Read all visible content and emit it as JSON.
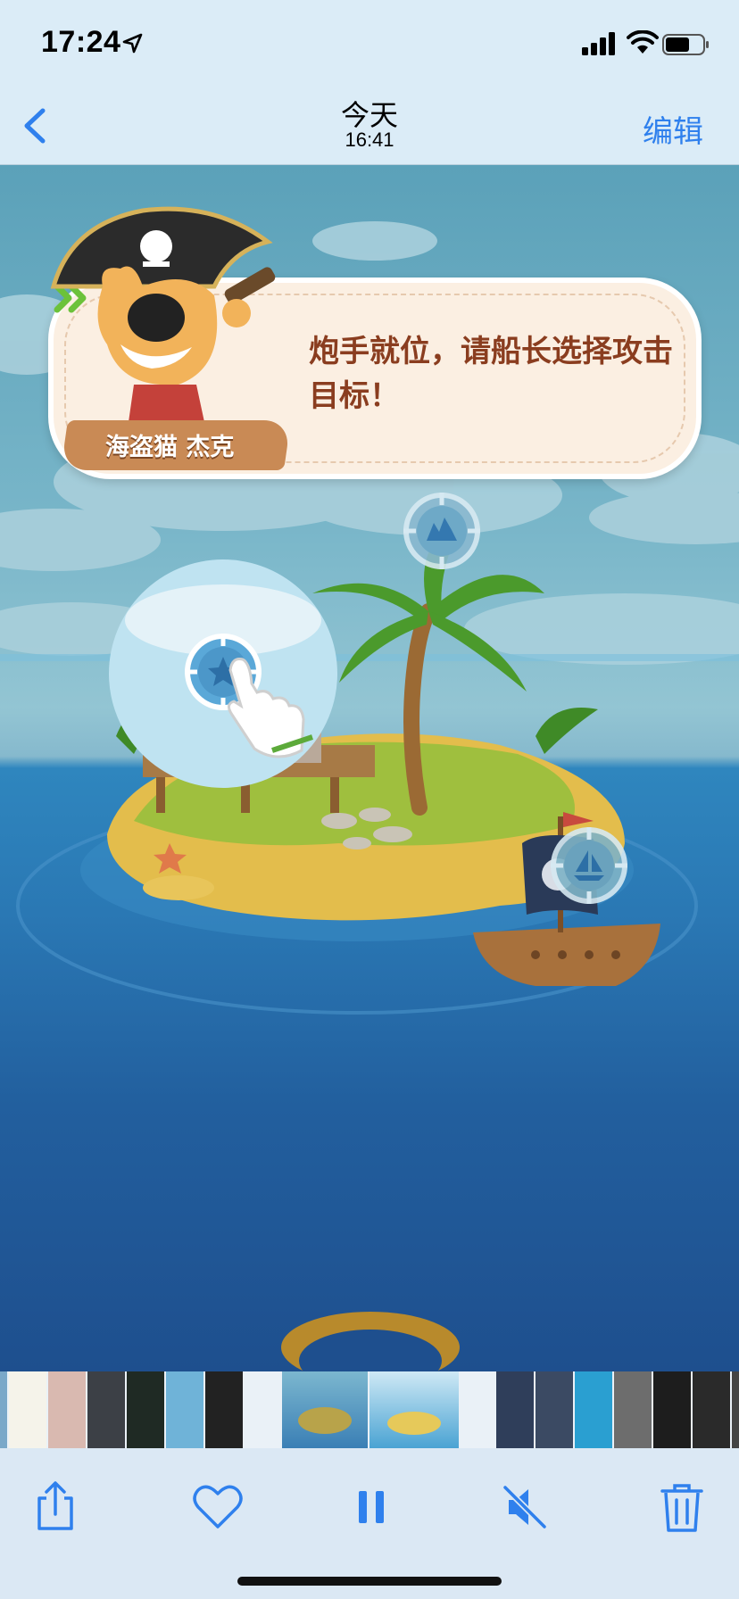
{
  "status_bar": {
    "time": "17:24",
    "icons": [
      "location-arrow-icon",
      "cellular-signal-icon",
      "wifi-icon",
      "battery-icon"
    ]
  },
  "nav": {
    "back_icon": "chevron-left-icon",
    "title": "今天",
    "subtitle": "16:41",
    "edit_label": "编辑",
    "accent": "#2f80ed"
  },
  "game": {
    "dialog_text": "炮手就位，请船长选择攻击目标！",
    "speaker_name": "海盗猫 杰克",
    "next_icon": "double-chevron-right-icon",
    "targets": [
      "starfish-target",
      "mountain-target",
      "boat-target"
    ]
  },
  "filmstrip": {
    "selected_index": 7,
    "thumb_count": 17
  },
  "toolbar": {
    "icons": [
      "share-icon",
      "heart-icon",
      "pause-icon",
      "mute-icon",
      "trash-icon"
    ]
  }
}
